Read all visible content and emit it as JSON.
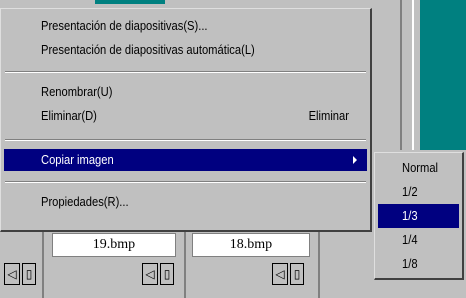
{
  "menu": {
    "items": [
      {
        "label": "Presentación de diapositivas(S)...",
        "shortcut": ""
      },
      {
        "label": "Presentación de diapositivas automática(L)",
        "shortcut": ""
      },
      {
        "label": "Renombrar(U)",
        "shortcut": ""
      },
      {
        "label": "Eliminar(D)",
        "shortcut": "Eliminar"
      },
      {
        "label": "Copiar imagen",
        "shortcut": ""
      },
      {
        "label": "Propiedades(R)...",
        "shortcut": ""
      }
    ]
  },
  "submenu": {
    "items": [
      {
        "label": "Normal"
      },
      {
        "label": "1/2"
      },
      {
        "label": "1/3"
      },
      {
        "label": "1/4"
      },
      {
        "label": "1/8"
      }
    ]
  },
  "thumbnails": [
    {
      "filename": "19.bmp"
    },
    {
      "filename": "18.bmp"
    }
  ],
  "colors": {
    "highlight": "#000080",
    "teal": "#008080"
  }
}
